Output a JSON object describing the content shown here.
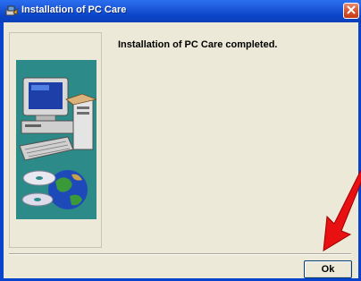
{
  "window": {
    "title": "Installation of PC Care",
    "close_icon": "close-x-icon",
    "title_icon": "setup-icon"
  },
  "main": {
    "message": "Installation of PC Care completed.",
    "illustration": "computer-and-globe-illustration"
  },
  "buttons": {
    "ok_label": "Ok"
  },
  "annotation": {
    "arrow_color": "#e81010",
    "arrow_icon": "red-pointer-arrow-icon"
  },
  "colors": {
    "title_bar": "#0a45c8",
    "dialog_bg": "#ece9d8",
    "illustration_bg": "#2c8b89",
    "close_button": "#d8542e"
  }
}
